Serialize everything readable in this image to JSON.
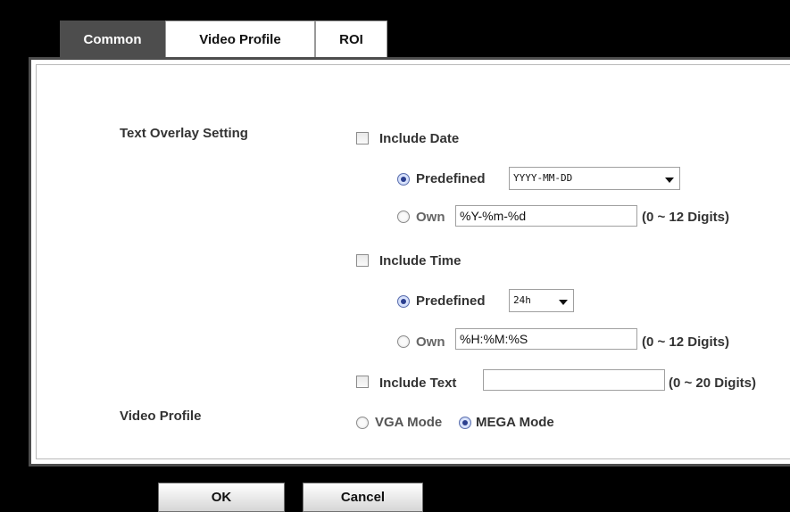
{
  "tabs": [
    {
      "label": "Common"
    },
    {
      "label": "Video Profile"
    },
    {
      "label": "ROI"
    }
  ],
  "text_overlay": {
    "section_label": "Text Overlay Setting",
    "include_date": {
      "label": "Include Date",
      "checked": false,
      "predefined_label": "Predefined",
      "predefined_value": "YYYY-MM-DD",
      "own_label": "Own",
      "own_value": "%Y-%m-%d",
      "own_hint": "(0 ~ 12 Digits)"
    },
    "include_time": {
      "label": "Include Time",
      "checked": false,
      "predefined_label": "Predefined",
      "predefined_value": "24h",
      "own_label": "Own",
      "own_value": "%H:%M:%S",
      "own_hint": "(0 ~ 12 Digits)"
    },
    "include_text": {
      "label": "Include Text",
      "checked": false,
      "value": "",
      "hint": "(0 ~ 20 Digits)"
    }
  },
  "video_profile": {
    "section_label": "Video Profile",
    "vga_label": "VGA Mode",
    "mega_label": "MEGA Mode",
    "selected": "MEGA Mode"
  },
  "buttons": {
    "ok_label": "OK",
    "cancel_label": "Cancel"
  }
}
